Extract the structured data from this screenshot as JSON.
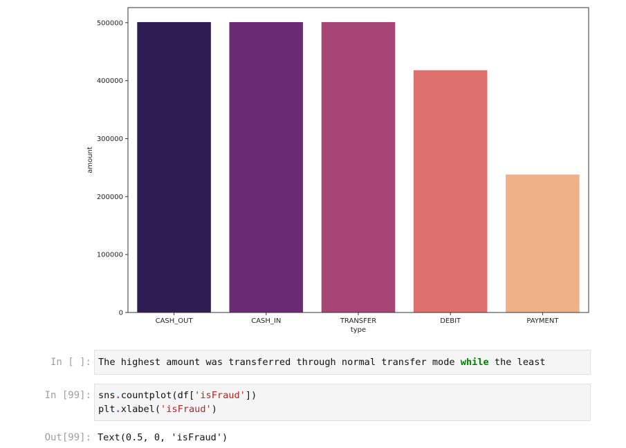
{
  "chart_data": {
    "type": "bar",
    "categories": [
      "CASH_OUT",
      "CASH_IN",
      "TRANSFER",
      "DEBIT",
      "PAYMENT"
    ],
    "values": [
      501000,
      501000,
      501000,
      418000,
      238000
    ],
    "colors": [
      "#2e1c53",
      "#6a2a74",
      "#a64576",
      "#de716e",
      "#efb188"
    ],
    "xlabel": "type",
    "ylabel": "amount",
    "yticks": [
      0,
      100000,
      200000,
      300000,
      400000,
      500000
    ],
    "ytick_labels": [
      "0",
      "100000",
      "200000",
      "300000",
      "400000",
      "500000"
    ],
    "ylim": [
      0,
      526000
    ],
    "grid": false
  },
  "cells": {
    "markdown": {
      "prompt": "In [ ]:",
      "text_before": "The highest amount was transferred through normal transfer mode ",
      "keyword": "while",
      "text_after": " the least"
    },
    "code99": {
      "prompt": "In [99]:",
      "line1": {
        "a": "sns",
        "dot": ".",
        "b": "countplot(df[",
        "s": "'isFraud'",
        "c": "])"
      },
      "line2": {
        "a": "plt",
        "dot": ".",
        "b": "xlabel(",
        "s": "'isFraud'",
        "c": ")"
      }
    },
    "out99": {
      "prompt": "Out[99]:",
      "text": "Text(0.5, 0, 'isFraud')"
    }
  }
}
